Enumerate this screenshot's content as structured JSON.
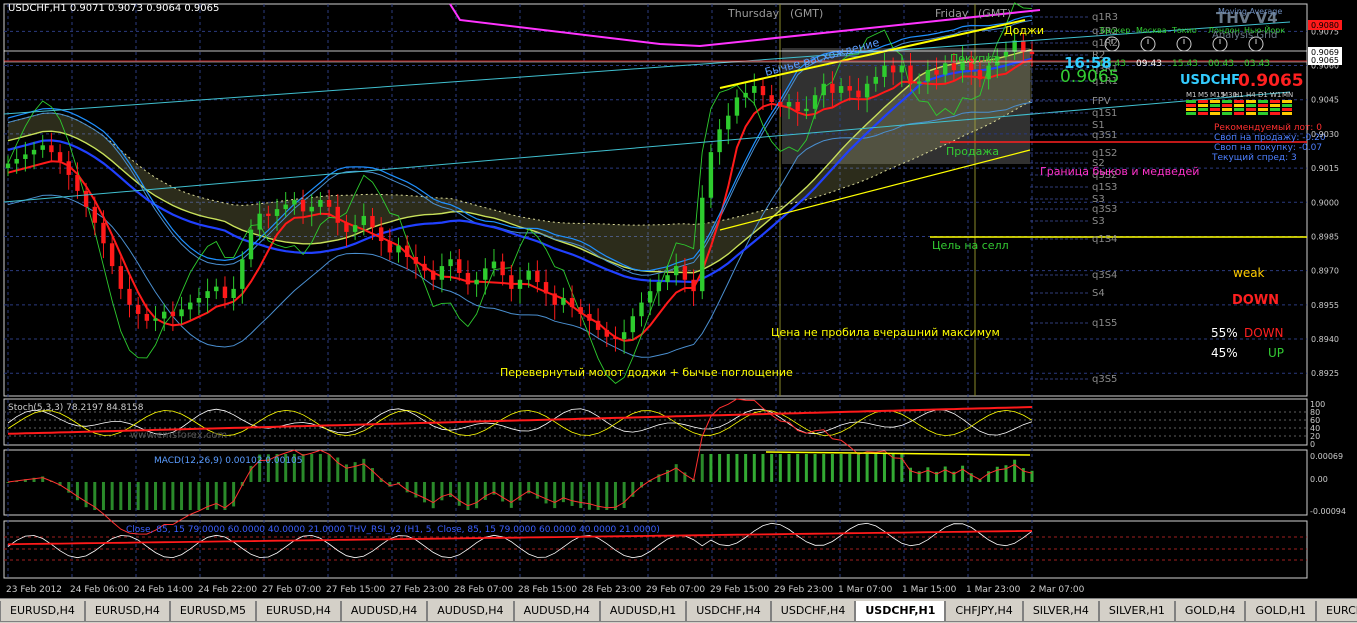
{
  "window": {
    "symbol_info": "USDCHF,H1  0.9071  0.9073  0.9064  0.9065",
    "session_labels": [
      "Thursday",
      "(GMT)",
      "Friday",
      "(GMT)"
    ]
  },
  "tabs": [
    {
      "label": "EURUSD,H4",
      "active": false
    },
    {
      "label": "EURUSD,H4",
      "active": false
    },
    {
      "label": "EURUSD,M5",
      "active": false
    },
    {
      "label": "EURUSD,H4",
      "active": false
    },
    {
      "label": "AUDUSD,H4",
      "active": false
    },
    {
      "label": "AUDUSD,H4",
      "active": false
    },
    {
      "label": "AUDUSD,H4",
      "active": false
    },
    {
      "label": "AUDUSD,H1",
      "active": false
    },
    {
      "label": "USDCHF,H4",
      "active": false
    },
    {
      "label": "USDCHF,H4",
      "active": false
    },
    {
      "label": "USDCHF,H1",
      "active": true
    },
    {
      "label": "CHFJPY,H4",
      "active": false
    },
    {
      "label": "SILVER,H4",
      "active": false
    },
    {
      "label": "SILVER,H1",
      "active": false
    },
    {
      "label": "GOLD,H4",
      "active": false
    },
    {
      "label": "GOLD,H1",
      "active": false
    },
    {
      "label": "EURCHF,H1",
      "active": false
    }
  ],
  "annotations": {
    "doji": "Доджи",
    "bullish_divergence": "Бычье расхождение",
    "buy": "Покупка",
    "sell": "Продажа",
    "bull_bear_border": "Граница быков и медведей",
    "sell_target": "Цель на селл",
    "no_break": "Цена не пробила вчерашний максимум",
    "hammer": "Перевернутый молот доджи + бычье поглощение"
  },
  "pivot_labels": [
    "q1R3",
    "q3R2",
    "q1R2",
    "R2",
    "q3R1",
    "q1R1",
    "FPV",
    "q1S1",
    "S1",
    "q3S1",
    "q1S2",
    "S2",
    "q3S2",
    "q1S3",
    "S3",
    "q3S3",
    "S3",
    "q1S4",
    "q3S4",
    "S4",
    "q1S5",
    "q3S5"
  ],
  "right_panel": {
    "title": "THV V4",
    "mode": "Moving Average",
    "clocks": [
      {
        "city": "Брокер",
        "time": "09:43"
      },
      {
        "city": "Москва",
        "time": "09:43"
      },
      {
        "city": "Токио",
        "time": "15:43"
      },
      {
        "city": "Лондон",
        "time": "00:43"
      },
      {
        "city": "Нью-Йорк",
        "time": "03:43"
      }
    ],
    "analysis": "Analysis Grid",
    "countdown": "16:58",
    "big_price": "0.9065",
    "pair": "USDCHF",
    "pair_price": "0.9065",
    "timeframes": [
      "M1",
      "M5",
      "M15",
      "M30",
      "H1",
      "H4",
      "D1",
      "W1",
      "MN"
    ],
    "lot": "Рекомендуемый лот: 0",
    "swap_sell": "Своп на продажу: -0.20",
    "swap_buy": "Своп на покупку: -0.07",
    "spread": "Текущий спред: 3",
    "weak": "weak",
    "direction": "DOWN",
    "pct_down": "55%",
    "down_label": "DOWN",
    "pct_up": "45%",
    "up_label": "UP"
  },
  "indicators": {
    "stoch_label": "Stoch(5,3,3) 78.2197 84.8158",
    "watermark": "www.cmsforex.com",
    "macd_label": "MACD(12,26,9) 0.00102 0.00105",
    "rsi_label": "Close, 85, 15 79.0000 60.0000 40.0000 21.0000    THV_RSI_v2 (H1, 5, Close, 85, 15 79.0000 60.0000 40.0000 21.0000)",
    "stoch_levels": [
      "100",
      "80",
      "60",
      "40",
      "20",
      "0"
    ],
    "macd_levels": [
      "0.00069",
      "0.00",
      "-0.00094"
    ]
  },
  "chart_data": {
    "type": "candlestick",
    "symbol": "USDCHF",
    "timeframe": "H1",
    "ylim": [
      0.8915,
      0.9087
    ],
    "price_ticks": [
      "0.9090",
      "0.9075",
      "0.9060",
      "0.9045",
      "0.9030",
      "0.9015",
      "0.9000",
      "0.8985",
      "0.8970",
      "0.8955",
      "0.8940",
      "0.8925"
    ],
    "highlight_prices": [
      "0.9080",
      "0.9069",
      "0.9065"
    ],
    "time_ticks": [
      "23 Feb 2012",
      "24 Feb 06:00",
      "24 Feb 14:00",
      "24 Feb 22:00",
      "27 Feb 07:00",
      "27 Feb 15:00",
      "27 Feb 23:00",
      "28 Feb 07:00",
      "28 Feb 15:00",
      "28 Feb 23:00",
      "29 Feb 07:00",
      "29 Feb 15:00",
      "29 Feb 23:00",
      "1 Mar 07:00",
      "1 Mar 15:00",
      "1 Mar 23:00",
      "2 Mar 07:00"
    ],
    "close": [
      0.9017,
      0.9019,
      0.9021,
      0.9023,
      0.9025,
      0.9022,
      0.9018,
      0.9012,
      0.9005,
      0.8998,
      0.8991,
      0.8982,
      0.8972,
      0.8962,
      0.8955,
      0.8951,
      0.8948,
      0.8949,
      0.8952,
      0.895,
      0.8953,
      0.8956,
      0.8958,
      0.8961,
      0.8963,
      0.8958,
      0.8962,
      0.8975,
      0.8988,
      0.8995,
      0.8994,
      0.8997,
      0.8999,
      0.9001,
      0.8996,
      0.8998,
      0.9001,
      0.8998,
      0.8991,
      0.8987,
      0.899,
      0.8994,
      0.8989,
      0.8983,
      0.8978,
      0.8981,
      0.8976,
      0.8973,
      0.897,
      0.8966,
      0.8972,
      0.8975,
      0.8969,
      0.8964,
      0.8966,
      0.8971,
      0.8974,
      0.8968,
      0.8962,
      0.8966,
      0.897,
      0.8965,
      0.896,
      0.8955,
      0.8958,
      0.8954,
      0.8951,
      0.8948,
      0.8944,
      0.8941,
      0.894,
      0.8943,
      0.895,
      0.8956,
      0.8961,
      0.8965,
      0.8968,
      0.8972,
      0.8966,
      0.8961,
      0.9002,
      0.9022,
      0.9032,
      0.9038,
      0.9046,
      0.9048,
      0.9051,
      0.9047,
      0.9044,
      0.9042,
      0.9044,
      0.904,
      0.9041,
      0.9047,
      0.9052,
      0.9048,
      0.9051,
      0.9049,
      0.9046,
      0.9052,
      0.9055,
      0.906,
      0.9057,
      0.906,
      0.9052,
      0.9053,
      0.9058,
      0.9056,
      0.9061,
      0.9058,
      0.9063,
      0.9058,
      0.9054,
      0.906,
      0.9064,
      0.9066,
      0.9071,
      0.9066,
      0.9065
    ]
  }
}
